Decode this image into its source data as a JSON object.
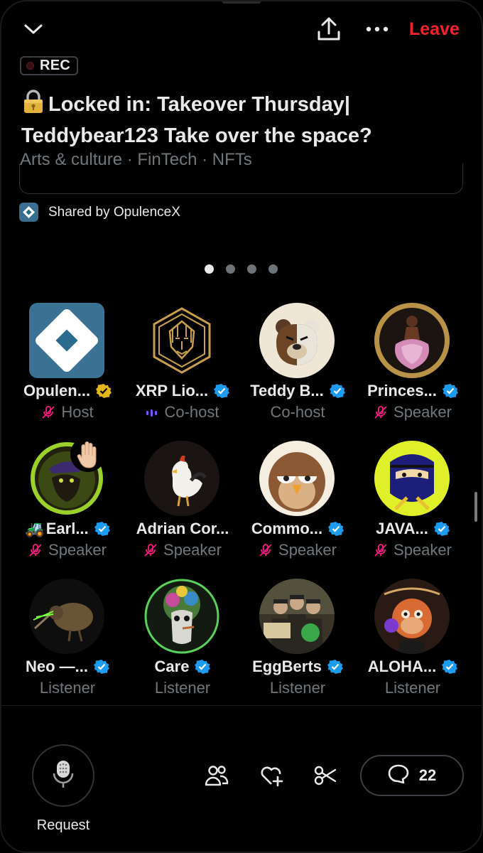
{
  "header": {
    "leave_label": "Leave",
    "icons": [
      "chevron-down-icon",
      "share-icon",
      "more-icon"
    ]
  },
  "space": {
    "rec_label": "REC",
    "title": "Locked in: Takeover Thursday| Teddybear123 Take over the space?",
    "title_icon": "lock-icon",
    "topics": "Arts & culture · FinTech · NFTs",
    "shared_by": "Shared by OpulenceX"
  },
  "pager": {
    "pages": 4,
    "active": 0
  },
  "participants": [
    {
      "name": "Opulen...",
      "role": "Host",
      "verified": "gold",
      "muted": true,
      "speaking": false
    },
    {
      "name": "XRP Lio...",
      "role": "Co-host",
      "verified": "blue",
      "muted": false,
      "speaking": true
    },
    {
      "name": "Teddy B...",
      "role": "Co-host",
      "verified": "blue",
      "muted": false,
      "speaking": false
    },
    {
      "name": "Princes...",
      "role": "Speaker",
      "verified": "blue",
      "muted": true,
      "speaking": false
    },
    {
      "name": "Earl...",
      "role": "Speaker",
      "verified": "blue",
      "muted": true,
      "speaking": false,
      "name_emoji": "🚜",
      "hand_raised": true
    },
    {
      "name": "Adrian Cor...",
      "role": "Speaker",
      "verified": "none",
      "muted": true,
      "speaking": false
    },
    {
      "name": "Commo...",
      "role": "Speaker",
      "verified": "blue",
      "muted": true,
      "speaking": false
    },
    {
      "name": "JAVA...",
      "role": "Speaker",
      "verified": "blue",
      "muted": true,
      "speaking": false
    },
    {
      "name": "Neo —...",
      "role": "Listener",
      "verified": "blue",
      "muted": false,
      "speaking": false
    },
    {
      "name": "Care",
      "role": "Listener",
      "verified": "blue",
      "muted": false,
      "speaking": false
    },
    {
      "name": "EggBerts",
      "role": "Listener",
      "verified": "blue",
      "muted": false,
      "speaking": false
    },
    {
      "name": "ALOHA...",
      "role": "Listener",
      "verified": "blue",
      "muted": false,
      "speaking": false
    }
  ],
  "bottom": {
    "request_label": "Request",
    "comment_count": "22",
    "icons": [
      "microphone-icon",
      "people-icon",
      "heart-plus-icon",
      "scissors-icon",
      "comment-icon"
    ]
  },
  "colors": {
    "leave": "#f4212e",
    "verified_blue": "#1d9bf0",
    "verified_gold": "#e2b719",
    "muted": "#f91880",
    "cohost_wave": "#7856ff",
    "secondary_text": "#71767b"
  }
}
